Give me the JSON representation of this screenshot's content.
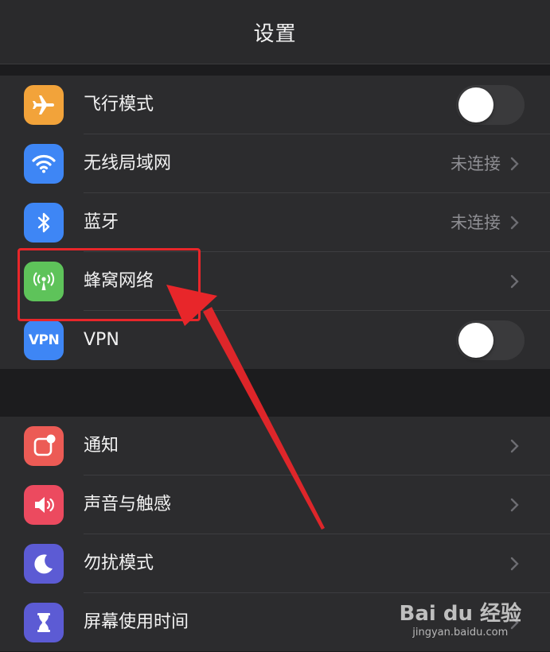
{
  "header": {
    "title": "设置"
  },
  "group1": [
    {
      "label": "飞行模式",
      "icon": "airplane-icon",
      "color": "#f2a33a",
      "control": "toggle",
      "on": false
    },
    {
      "label": "无线局域网",
      "icon": "wifi-icon",
      "color": "#3e86f5",
      "control": "chevron",
      "value": "未连接"
    },
    {
      "label": "蓝牙",
      "icon": "bluetooth-icon",
      "color": "#3e86f5",
      "control": "chevron",
      "value": "未连接"
    },
    {
      "label": "蜂窝网络",
      "icon": "cellular-icon",
      "color": "#5ec35a",
      "control": "chevron"
    },
    {
      "label": "VPN",
      "icon": "vpn-icon",
      "icon_text": "VPN",
      "color": "#3e86f5",
      "control": "toggle",
      "on": false
    }
  ],
  "group2": [
    {
      "label": "通知",
      "icon": "notifications-icon",
      "color": "#ec5b55",
      "control": "chevron"
    },
    {
      "label": "声音与触感",
      "icon": "speaker-icon",
      "color": "#ec4a5f",
      "control": "chevron"
    },
    {
      "label": "勿扰模式",
      "icon": "moon-icon",
      "color": "#5c5bd4",
      "control": "chevron"
    },
    {
      "label": "屏幕使用时间",
      "icon": "hourglass-icon",
      "color": "#5c5bd4",
      "control": "chevron"
    }
  ],
  "annotation": {
    "highlight_color": "#e8262a"
  },
  "watermark": {
    "brand": "Bai du 经验",
    "url": "jingyan.baidu.com"
  }
}
